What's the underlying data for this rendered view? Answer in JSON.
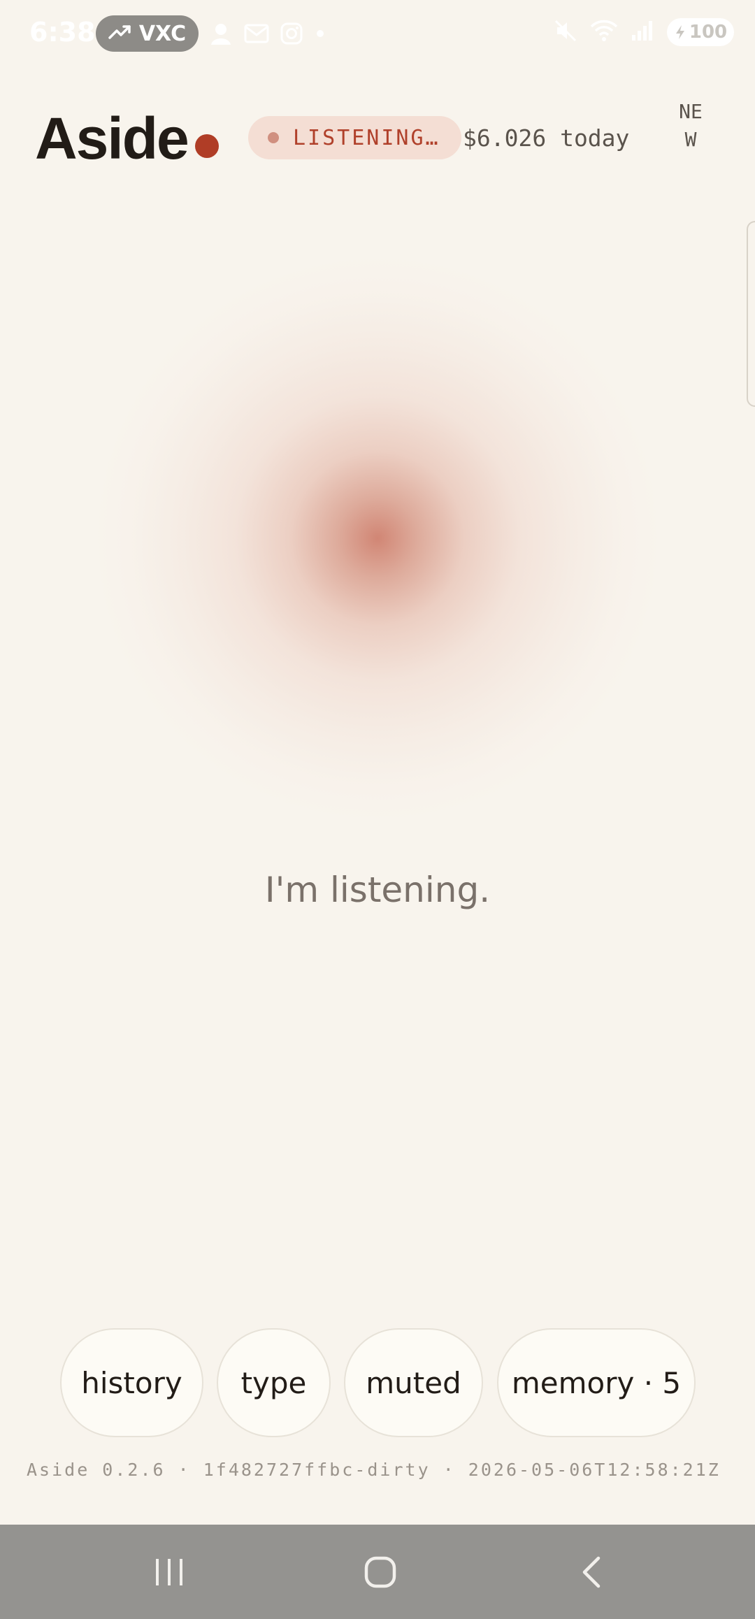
{
  "status_bar": {
    "time": "6:38",
    "ticker_pill": "VXC",
    "battery": "100",
    "icons_left": [
      "trending-up-icon",
      "person-icon",
      "gmail-icon",
      "instagram-icon",
      "dot-icon"
    ],
    "icons_right": [
      "mute-icon",
      "wifi-icon",
      "signal-icon",
      "battery-icon"
    ]
  },
  "header": {
    "title": "Aside",
    "status_label": "LISTENING…",
    "cost": "$6.026 today",
    "new_button": "NEW"
  },
  "main": {
    "listening_message": "I'm listening."
  },
  "actions": [
    {
      "label": "history"
    },
    {
      "label": "type"
    },
    {
      "label": "muted"
    },
    {
      "label": "memory · 5"
    }
  ],
  "footer": {
    "version": "Aside 0.2.6 · 1f482727ffbc-dirty · 2026-05-06T12:58:21Z"
  },
  "navbar": {
    "buttons": [
      "recent-apps-icon",
      "home-icon",
      "back-icon"
    ]
  },
  "colors": {
    "background": "#f8f4ed",
    "accent": "#b03d26",
    "pill_bg": "#f4ded4",
    "text_dark": "#221c17"
  }
}
